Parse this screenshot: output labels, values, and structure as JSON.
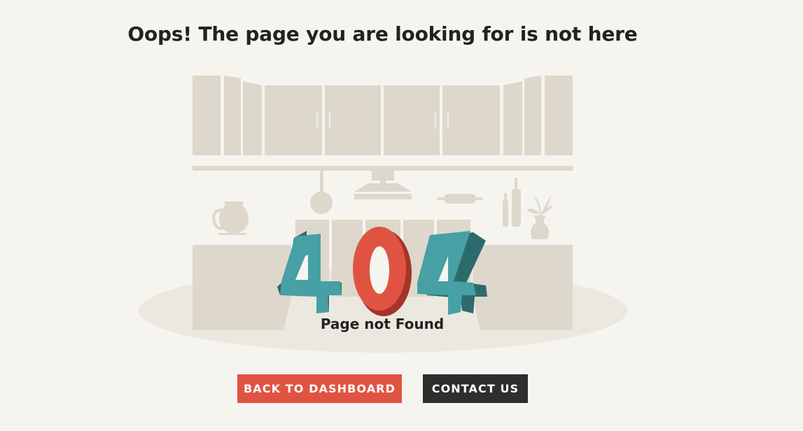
{
  "heading": "Oops! The page you are looking for is not here",
  "error": {
    "digits": [
      "4",
      "0",
      "4"
    ],
    "message": "Page not Found"
  },
  "actions": {
    "primary_label": "BACK TO DASHBOARD",
    "secondary_label": "CONTACT US"
  },
  "colors": {
    "background": "#f6f4ef",
    "illustration": "#ddd8cb",
    "teal": "#46a0a4",
    "teal_dark": "#2c6b6c",
    "red": "#e05342",
    "red_dark": "#a8332a",
    "dark_button": "#2e2e2e"
  },
  "icons": [
    "kitchen-illustration",
    "error-404-graphic"
  ]
}
